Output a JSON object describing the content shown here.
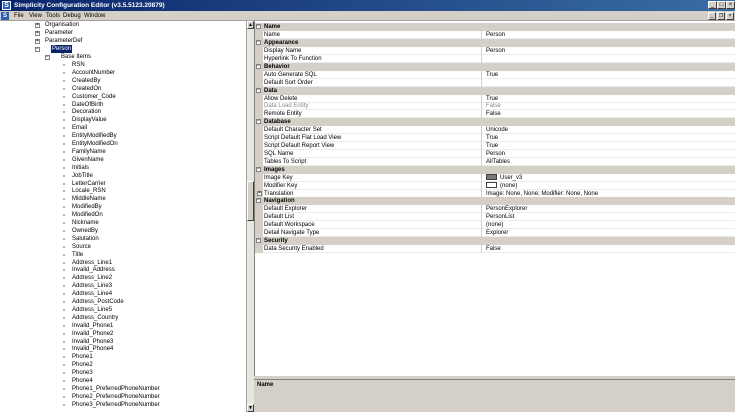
{
  "window": {
    "title": "Simplicity Configuration Editor (v3.5.5123.20879)",
    "controls": {
      "minimize": "_",
      "maximize": "□",
      "close": "×"
    }
  },
  "menu": {
    "items": [
      "File",
      "View",
      "Tools",
      "Debug",
      "Window"
    ],
    "mdi_controls": {
      "minimize": "_",
      "restore": "❐",
      "close": "×"
    }
  },
  "tree": {
    "nodes": [
      {
        "label": "Organisation",
        "toggle": "+"
      },
      {
        "label": "Parameter",
        "toggle": "+"
      },
      {
        "label": "ParameterDef",
        "toggle": "+"
      },
      {
        "label": "Person",
        "toggle": "−",
        "selected": true
      },
      {
        "label": "Base Items",
        "toggle": "−"
      }
    ],
    "base_items": [
      "RSN",
      "AccountNumber",
      "CreatedBy",
      "CreatedOn",
      "Customer_Code",
      "DateOfBirth",
      "Decoration",
      "DisplayValue",
      "Email",
      "EntityModifiedBy",
      "EntityModifiedOn",
      "FamilyName",
      "GivenName",
      "Initials",
      "JobTitle",
      "LetterCarrier",
      "Locale_RSN",
      "MiddleName",
      "ModifiedBy",
      "ModifiedOn",
      "Nickname",
      "OwnedBy",
      "Salutation",
      "Source",
      "Title",
      "Address_Line1",
      "Invalid_Address",
      "Address_Line2",
      "Address_Line3",
      "Address_Line4",
      "Address_PostCode",
      "Address_Line5",
      "Address_Country",
      "Invalid_Phone1",
      "Invalid_Phone2",
      "Invalid_Phone3",
      "Invalid_Phone4",
      "Phone1",
      "Phone2",
      "Phone3",
      "Phone4",
      "Phone1_PreferredPhoneNumber",
      "Phone2_PreferredPhoneNumber",
      "Phone3_PreferredPhoneNumber"
    ]
  },
  "scrollbar": {
    "up": "▲",
    "down": "▼"
  },
  "properties": [
    {
      "category": "Name",
      "rows": [
        {
          "name": "Name",
          "value": "Person"
        }
      ]
    },
    {
      "category": "Appearance",
      "rows": [
        {
          "name": "Display Name",
          "value": "Person"
        },
        {
          "name": "Hyperlink To Function",
          "value": ""
        }
      ]
    },
    {
      "category": "Behavior",
      "rows": [
        {
          "name": "Auto Generate SQL",
          "value": "True"
        },
        {
          "name": "Default Sort Order",
          "value": ""
        }
      ]
    },
    {
      "category": "Data",
      "rows": [
        {
          "name": "Allow Delete",
          "value": "True"
        },
        {
          "name": "Data Load Entity",
          "value": "False",
          "disabled": true
        },
        {
          "name": "Remote Entity",
          "value": "False"
        }
      ]
    },
    {
      "category": "Database",
      "rows": [
        {
          "name": "Default Character Set",
          "value": "Unicode"
        },
        {
          "name": "Script Default Flat Load View",
          "value": "True"
        },
        {
          "name": "Script Default Report View",
          "value": "True"
        },
        {
          "name": "SQL Name",
          "value": "Person"
        },
        {
          "name": "Tables To Script",
          "value": "AllTables"
        }
      ]
    },
    {
      "category": "Images",
      "rows": [
        {
          "name": "Image Key",
          "value": "User_v3",
          "swatch": "image"
        },
        {
          "name": "Modifier Key",
          "value": "(none)",
          "swatch": "empty"
        },
        {
          "name": "Translation",
          "value": "Image: None, None; Modifier: None, None",
          "expander": "+"
        }
      ]
    },
    {
      "category": "Navigation",
      "rows": [
        {
          "name": "Default Explorer",
          "value": "PersonExplorer"
        },
        {
          "name": "Default List",
          "value": "PersonList"
        },
        {
          "name": "Default Workspace",
          "value": "(none)"
        },
        {
          "name": "Detail Navigate Type",
          "value": "Explorer"
        }
      ]
    },
    {
      "category": "Security",
      "rows": [
        {
          "name": "Data Security Enabled",
          "value": "False"
        }
      ]
    }
  ],
  "description": {
    "title": "Name"
  },
  "category_toggle": "−"
}
